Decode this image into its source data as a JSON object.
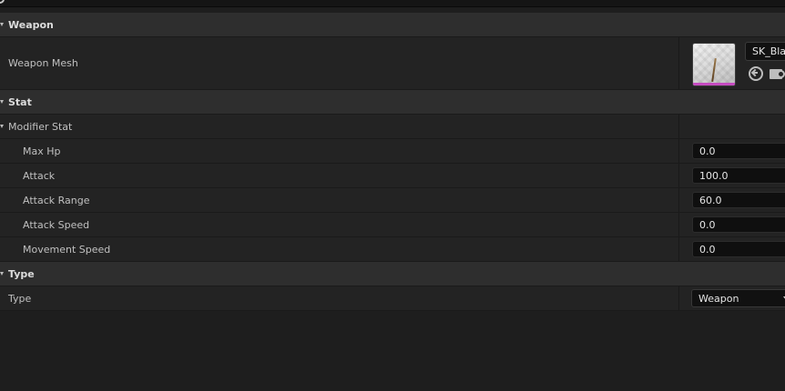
{
  "categories": {
    "weapon": "Weapon",
    "stat": "Stat",
    "type": "Type"
  },
  "weapon": {
    "mesh_label": "Weapon Mesh",
    "mesh_value": "SK_Blade"
  },
  "stat": {
    "modifier_label": "Modifier Stat",
    "fields": [
      {
        "label": "Max Hp",
        "value": "0.0"
      },
      {
        "label": "Attack",
        "value": "100.0"
      },
      {
        "label": "Attack Range",
        "value": "60.0"
      },
      {
        "label": "Attack Speed",
        "value": "0.0"
      },
      {
        "label": "Movement Speed",
        "value": "0.0"
      }
    ]
  },
  "type": {
    "label": "Type",
    "value": "Weapon"
  }
}
